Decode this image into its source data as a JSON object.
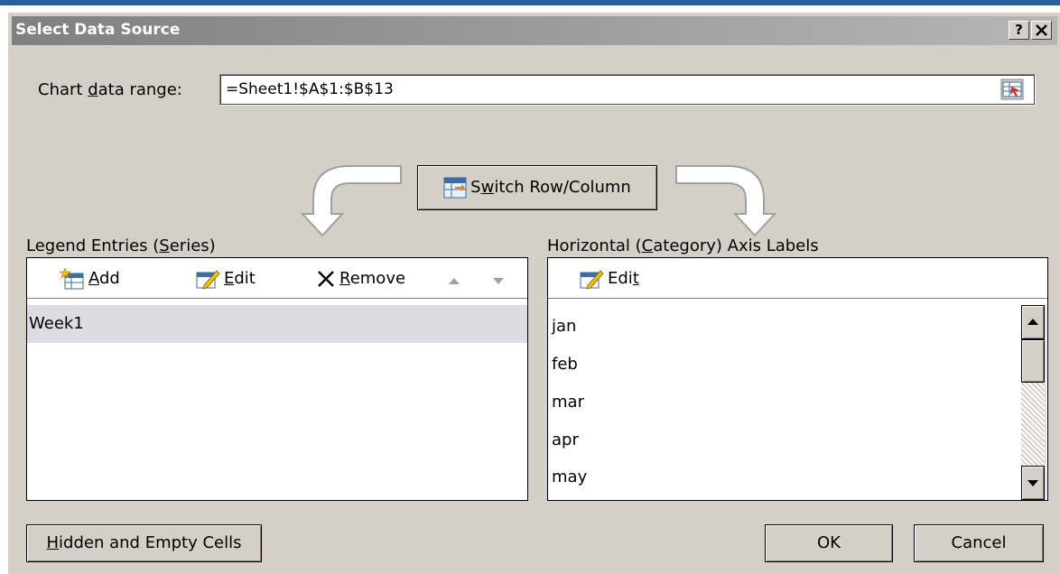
{
  "dialog": {
    "title": "Select Data Source",
    "help_button": "?",
    "close_button": "✕"
  },
  "chart_range": {
    "label_pre": "Chart ",
    "label_accel": "d",
    "label_post": "ata range:",
    "value": "=Sheet1!$A$1:$B$13"
  },
  "switch": {
    "label_pre": "S",
    "label_accel": "w",
    "label_post": "itch Row/Column"
  },
  "legend": {
    "title_pre": "Legend Entries (",
    "title_accel": "S",
    "title_post": "eries)",
    "add_accel": "A",
    "add_rest": "dd",
    "edit_accel": "E",
    "edit_rest": "dit",
    "remove_accel": "R",
    "remove_rest": "emove",
    "series": [
      "Week1"
    ]
  },
  "axis": {
    "title_pre": "Horizontal (",
    "title_accel": "C",
    "title_post": "ategory) Axis Labels",
    "edit_pre": "Edi",
    "edit_accel": "t",
    "labels": [
      "jan",
      "feb",
      "mar",
      "apr",
      "may"
    ]
  },
  "footer": {
    "hidden_accel": "H",
    "hidden_rest": "idden and Empty Cells",
    "ok": "OK",
    "cancel": "Cancel"
  },
  "colors": {
    "dialog_bg": "#d4d0c8",
    "titlebar": "#808080",
    "selection": "#dcdce2"
  },
  "icons": [
    "add-icon",
    "edit-icon",
    "remove-x-icon",
    "move-up-icon",
    "move-down-icon",
    "switch-icon",
    "range-picker-icon",
    "scroll-up-icon",
    "scroll-down-icon"
  ]
}
